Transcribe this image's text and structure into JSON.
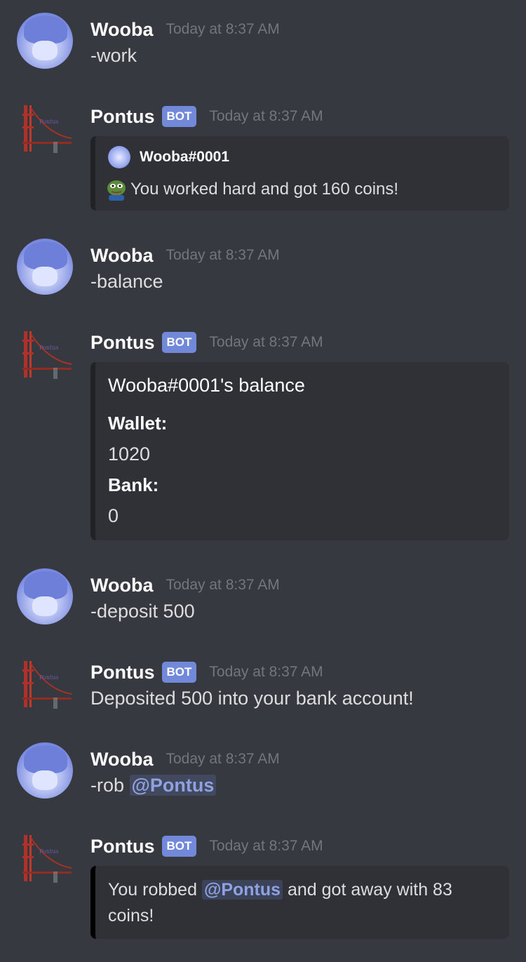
{
  "messages": [
    {
      "author": "Wooba",
      "time": "Today at 8:37 AM",
      "text": "-work"
    },
    {
      "author": "Pontus",
      "badge": "BOT",
      "time": "Today at 8:37 AM",
      "embed": {
        "author": "Wooba#0001",
        "emoji": "pepe-emoji",
        "description": "You worked hard and got 160 coins!"
      }
    },
    {
      "author": "Wooba",
      "time": "Today at 8:37 AM",
      "text": "-balance"
    },
    {
      "author": "Pontus",
      "badge": "BOT",
      "time": "Today at 8:37 AM",
      "embed": {
        "title": "Wooba#0001's balance",
        "fields": [
          {
            "name": "Wallet:",
            "value": "1020"
          },
          {
            "name": "Bank:",
            "value": "0"
          }
        ]
      }
    },
    {
      "author": "Wooba",
      "time": "Today at 8:37 AM",
      "text": "-deposit 500"
    },
    {
      "author": "Pontus",
      "badge": "BOT",
      "time": "Today at 8:37 AM",
      "text": "Deposited 500 into your bank account!"
    },
    {
      "author": "Wooba",
      "time": "Today at 8:37 AM",
      "text_prefix": "-rob ",
      "mention": "@Pontus"
    },
    {
      "author": "Pontus",
      "badge": "BOT",
      "time": "Today at 8:37 AM",
      "embed": {
        "text_before": "You robbed ",
        "mention": "@Pontus",
        "text_after": " and got away with 83 coins!"
      }
    }
  ],
  "colors": {
    "background": "#36393f",
    "embed_bg": "#2f3136",
    "badge": "#7289da",
    "mention": "#8ea1e1"
  }
}
